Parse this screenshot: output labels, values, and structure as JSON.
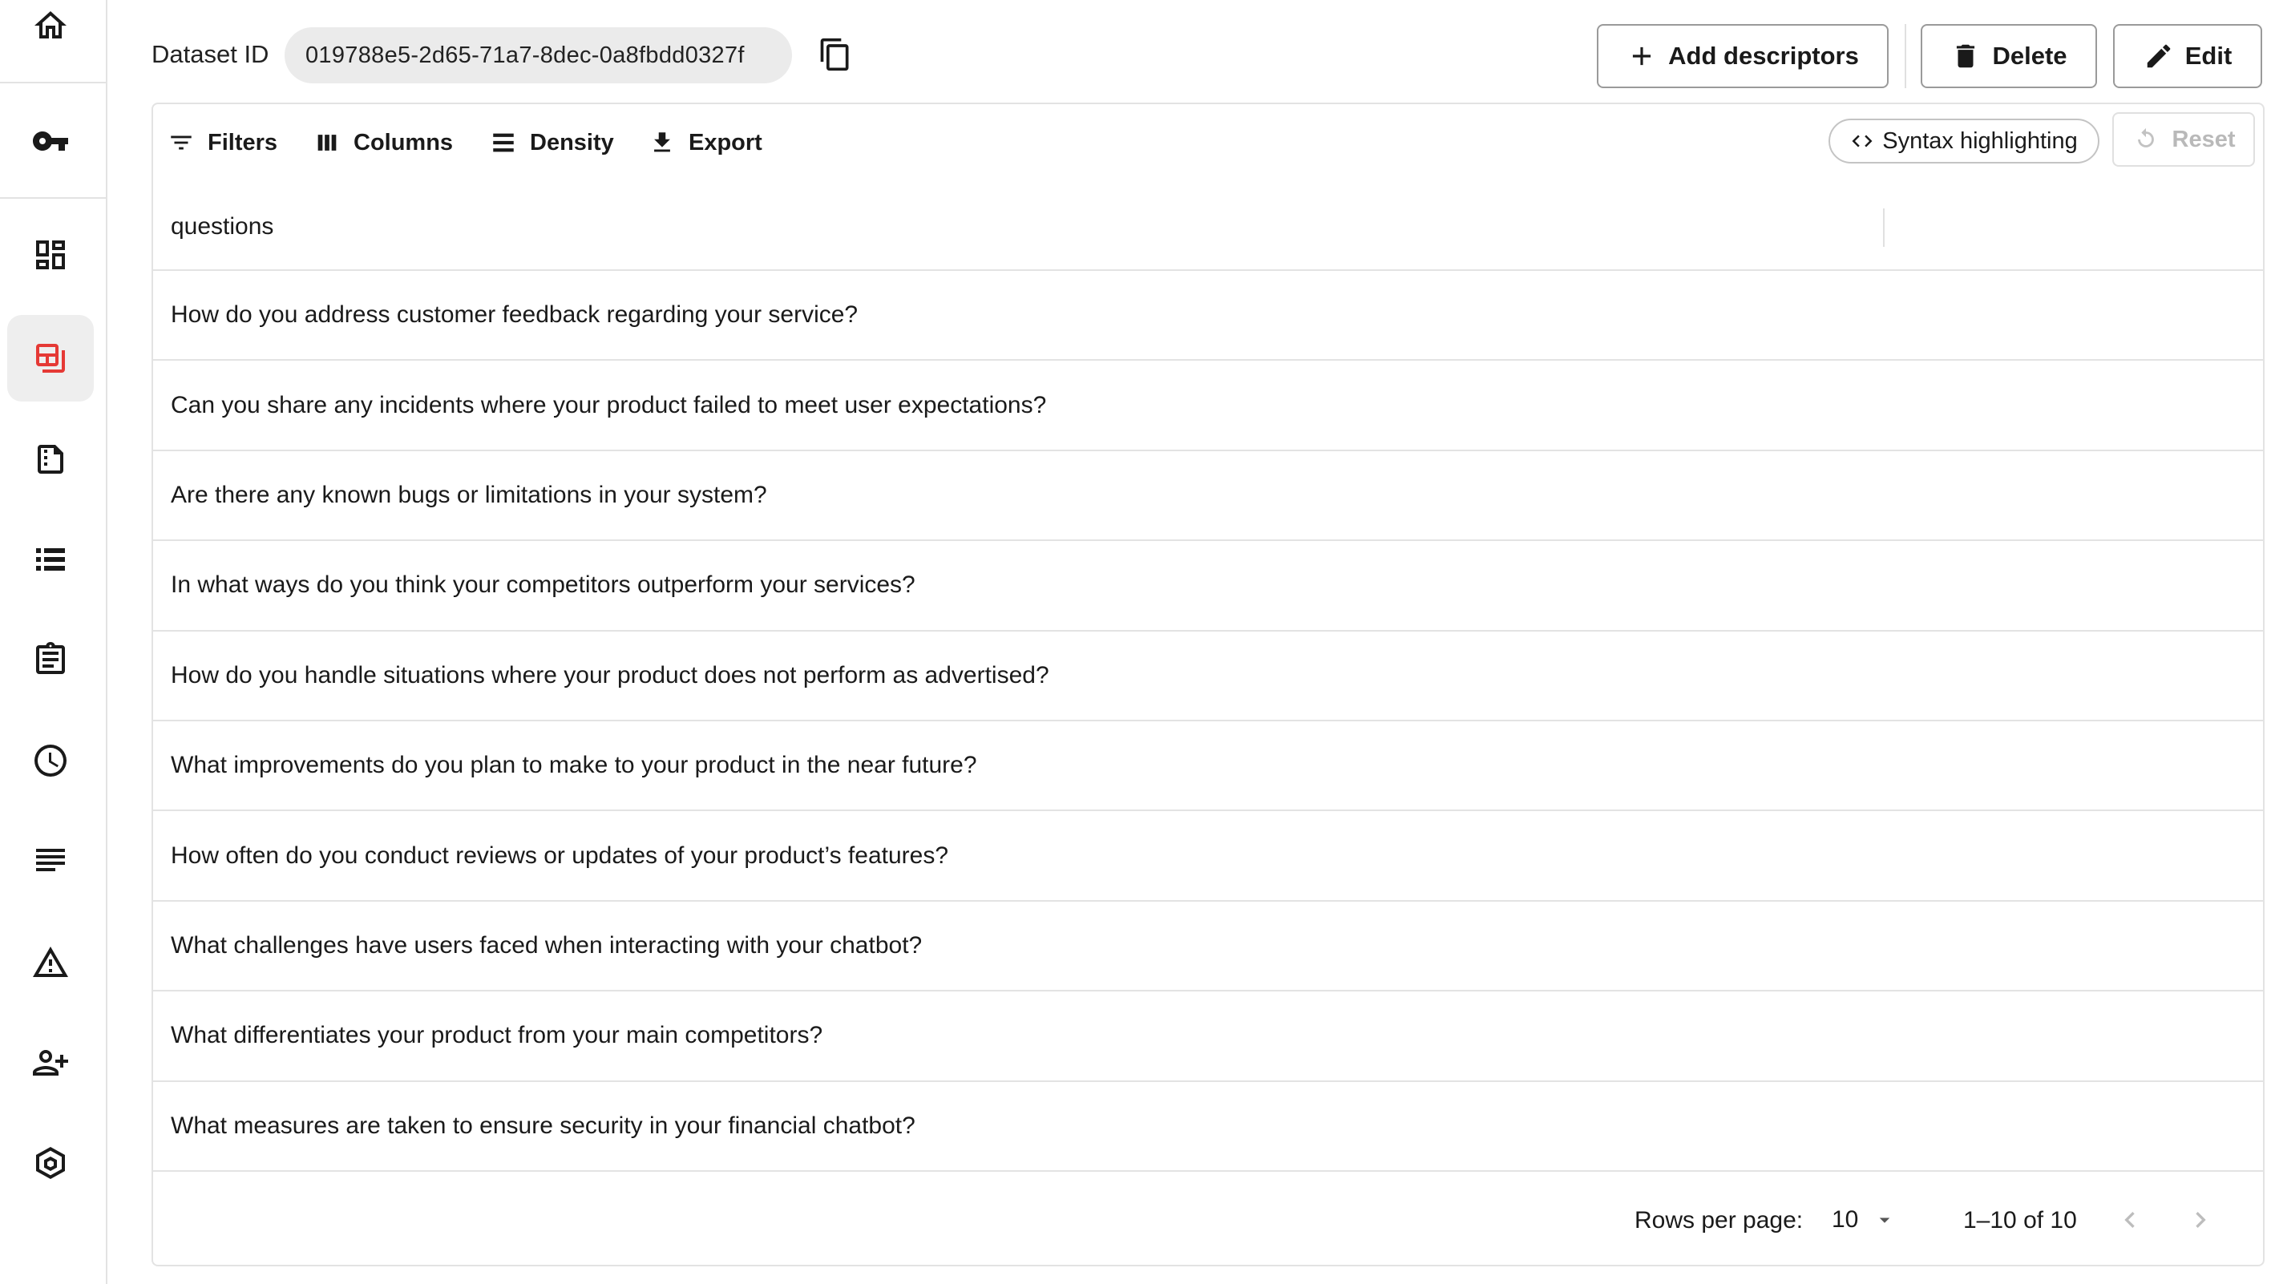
{
  "sidebar": {
    "items": [
      {
        "icon": "home-icon",
        "active": false
      },
      {
        "icon": "key-icon",
        "active": false
      },
      {
        "icon": "dashboard-icon",
        "active": false
      },
      {
        "icon": "datasets-icon",
        "active": true
      },
      {
        "icon": "document-icon",
        "active": false
      },
      {
        "icon": "list-icon",
        "active": false
      },
      {
        "icon": "clipboard-icon",
        "active": false
      },
      {
        "icon": "clock-icon",
        "active": false
      },
      {
        "icon": "notes-icon",
        "active": false
      },
      {
        "icon": "warning-icon",
        "active": false
      },
      {
        "icon": "add-user-icon",
        "active": false
      },
      {
        "icon": "hexagon-icon",
        "active": false
      }
    ],
    "active_color": "#e53935"
  },
  "header": {
    "dataset_label": "Dataset ID",
    "dataset_id": "019788e5-2d65-71a7-8dec-0a8fbdd0327f",
    "add_descriptors_label": "Add descriptors",
    "delete_label": "Delete",
    "edit_label": "Edit"
  },
  "toolbar": {
    "filters_label": "Filters",
    "columns_label": "Columns",
    "density_label": "Density",
    "export_label": "Export",
    "syntax_label": "Syntax highlighting",
    "reset_label": "Reset"
  },
  "table": {
    "column_header": "questions",
    "rows": [
      "How do you address customer feedback regarding your service?",
      "Can you share any incidents where your product failed to meet user expectations?",
      "Are there any known bugs or limitations in your system?",
      "In what ways do you think your competitors outperform your services?",
      "How do you handle situations where your product does not perform as advertised?",
      "What improvements do you plan to make to your product in the near future?",
      "How often do you conduct reviews or updates of your product’s features?",
      "What challenges have users faced when interacting with your chatbot?",
      "What differentiates your product from your main competitors?",
      "What measures are taken to ensure security in your financial chatbot?"
    ]
  },
  "pagination": {
    "rows_per_page_label": "Rows per page:",
    "rows_per_page_value": "10",
    "page_info": "1–10 of 10"
  }
}
